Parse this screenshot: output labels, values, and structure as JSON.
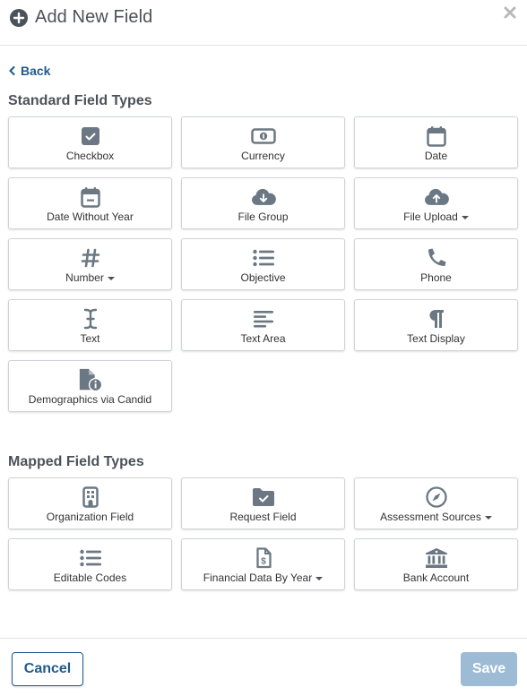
{
  "header": {
    "title": "Add New Field",
    "icon": "plus-circle-icon",
    "close_icon": "close-icon"
  },
  "back": {
    "label": "Back",
    "icon": "chevron-left-icon"
  },
  "standard": {
    "title": "Standard Field Types",
    "items": [
      {
        "label": "Checkbox",
        "icon": "checkbox-icon",
        "dropdown": false
      },
      {
        "label": "Currency",
        "icon": "money-bill-icon",
        "dropdown": false
      },
      {
        "label": "Date",
        "icon": "calendar-icon",
        "dropdown": false
      },
      {
        "label": "Date Without Year",
        "icon": "calendar-minus-icon",
        "dropdown": false
      },
      {
        "label": "File Group",
        "icon": "cloud-download-icon",
        "dropdown": false
      },
      {
        "label": "File Upload",
        "icon": "cloud-upload-icon",
        "dropdown": true
      },
      {
        "label": "Number",
        "icon": "hashtag-icon",
        "dropdown": true
      },
      {
        "label": "Objective",
        "icon": "list-icon",
        "dropdown": false
      },
      {
        "label": "Phone",
        "icon": "phone-icon",
        "dropdown": false
      },
      {
        "label": "Text",
        "icon": "text-cursor-icon",
        "dropdown": false
      },
      {
        "label": "Text Area",
        "icon": "align-left-icon",
        "dropdown": false
      },
      {
        "label": "Text Display",
        "icon": "paragraph-icon",
        "dropdown": false
      },
      {
        "label": "Demographics via Candid",
        "icon": "file-info-icon",
        "dropdown": false
      }
    ]
  },
  "mapped": {
    "title": "Mapped Field Types",
    "items": [
      {
        "label": "Organization Field",
        "icon": "building-icon",
        "dropdown": false
      },
      {
        "label": "Request Field",
        "icon": "folder-check-icon",
        "dropdown": false
      },
      {
        "label": "Assessment Sources",
        "icon": "compass-icon",
        "dropdown": true
      },
      {
        "label": "Editable Codes",
        "icon": "list-icon",
        "dropdown": false
      },
      {
        "label": "Financial Data By Year",
        "icon": "file-invoice-dollar-icon",
        "dropdown": true
      },
      {
        "label": "Bank Account",
        "icon": "bank-icon",
        "dropdown": false
      }
    ]
  },
  "footer": {
    "cancel_label": "Cancel",
    "save_label": "Save",
    "save_disabled": true
  },
  "colors": {
    "accent": "#1f5b8e",
    "icon": "#6b7884",
    "save_disabled_bg": "#9dbbd4"
  }
}
